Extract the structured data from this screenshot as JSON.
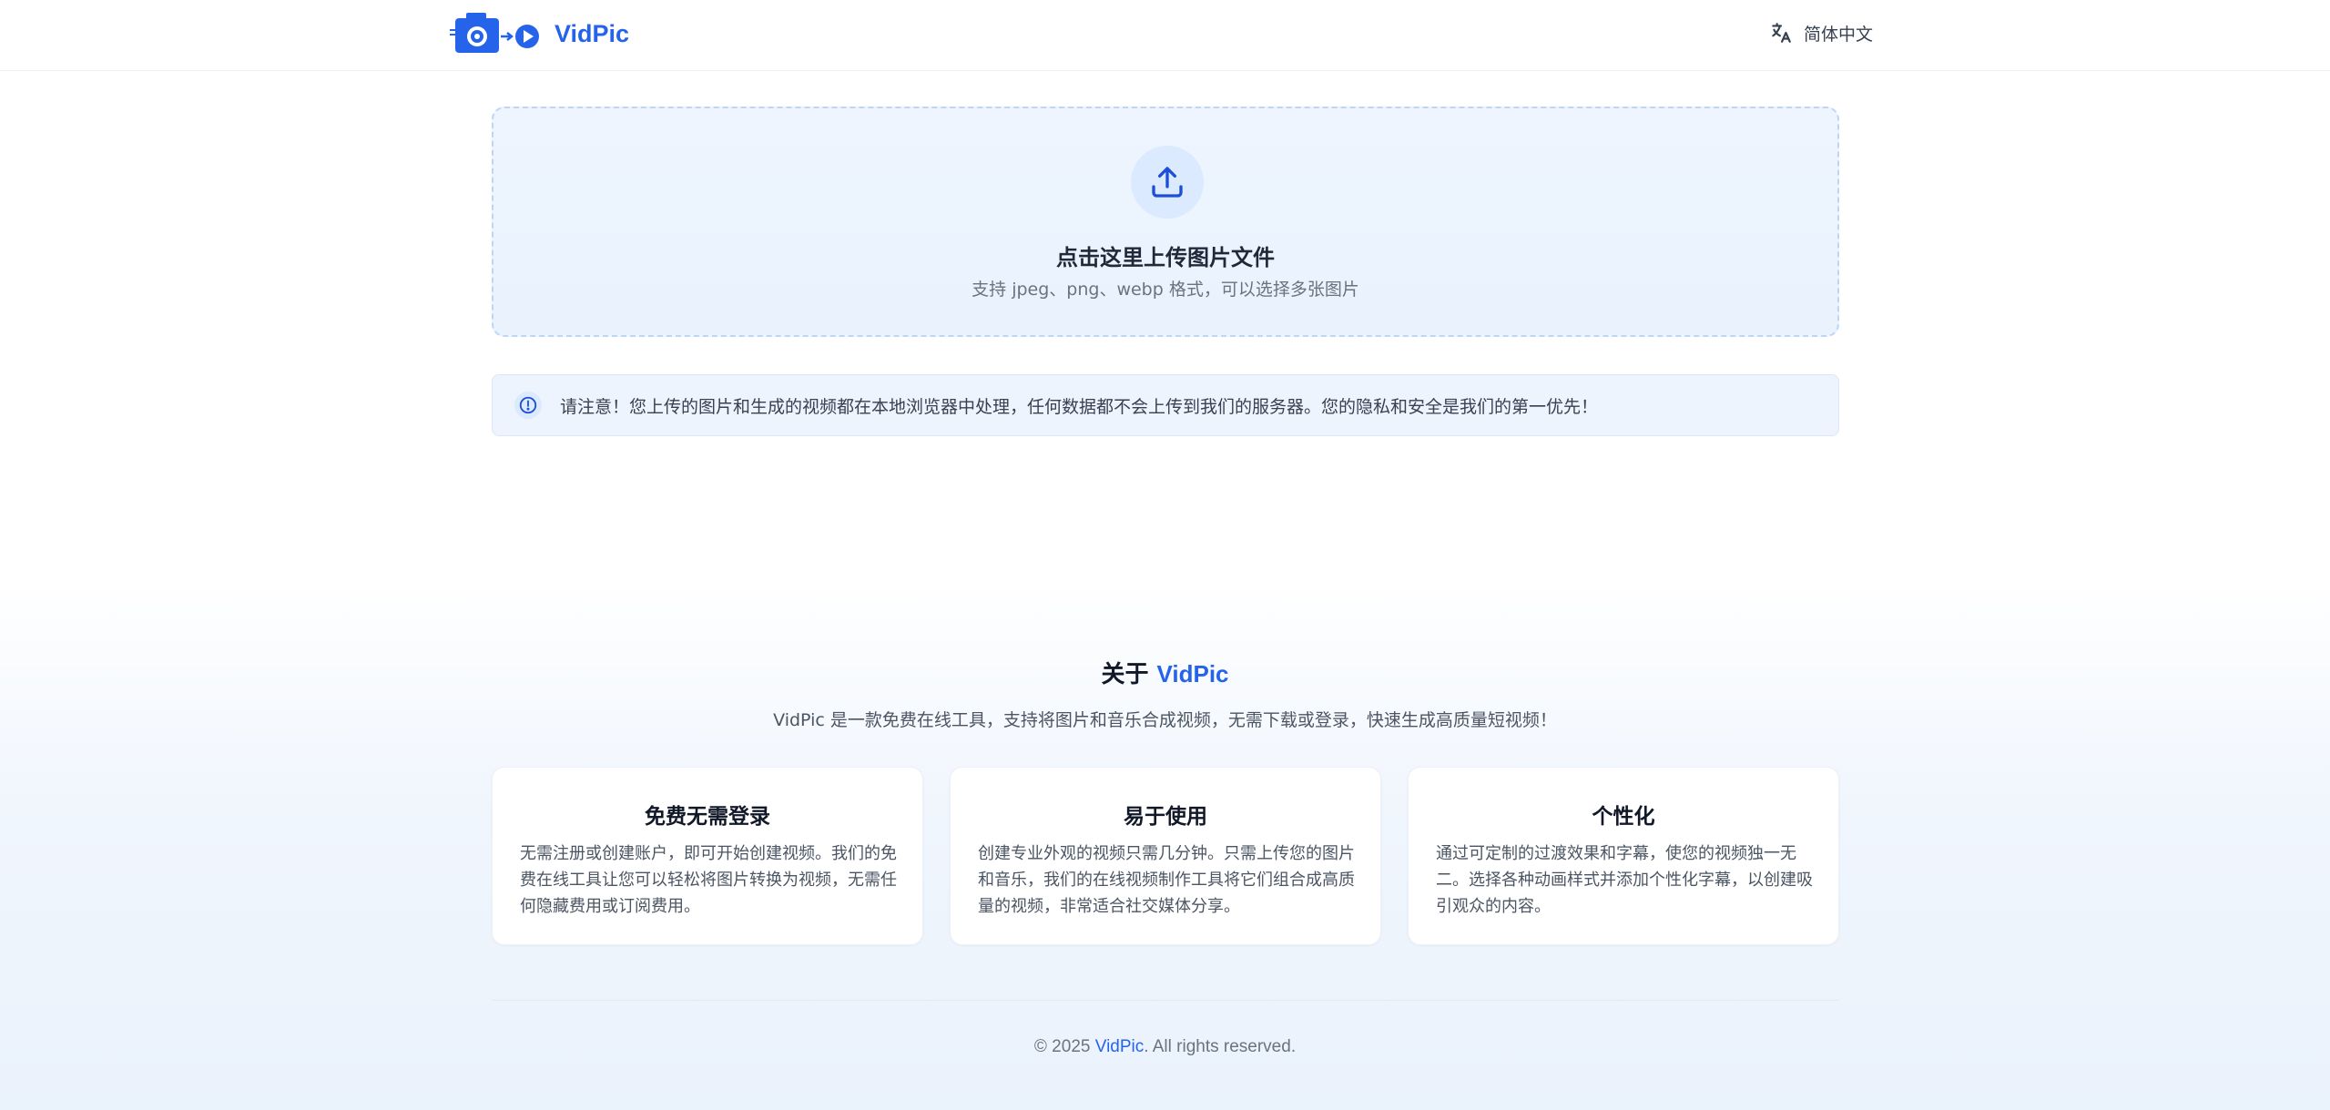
{
  "header": {
    "brand": "VidPic",
    "language_label": "简体中文",
    "logo_icon": "camera-to-play-icon",
    "language_icon": "translate-icon"
  },
  "upload": {
    "title": "点击这里上传图片文件",
    "subtitle": "支持 jpeg、png、webp 格式，可以选择多张图片",
    "icon": "upload-icon"
  },
  "notice": {
    "text": "请注意！您上传的图片和生成的视频都在本地浏览器中处理，任何数据都不会上传到我们的服务器。您的隐私和安全是我们的第一优先！",
    "icon": "info-circle-icon"
  },
  "about": {
    "title_prefix": "关于 ",
    "title_brand": "VidPic",
    "description": "VidPic 是一款免费在线工具，支持将图片和音乐合成视频，无需下载或登录，快速生成高质量短视频！"
  },
  "features": [
    {
      "title": "免费无需登录",
      "lines": [
        "无需注册或创建账户，即可开始创建视频。我们的免",
        "费在线工具让您可以轻松将图片转换为视频，无需任",
        "何隐藏费用或订阅费用。"
      ]
    },
    {
      "title": "易于使用",
      "lines": [
        "创建专业外观的视频只需几分钟。只需上传您的图片",
        "和音乐，我们的在线视频制作工具将它们组合成高质",
        "量的视频，非常适合社交媒体分享。"
      ]
    },
    {
      "title": "个性化",
      "lines": [
        "通过可定制的过渡效果和字幕，使您的视频独一无",
        "二。选择各种动画样式并添加个性化字幕，以创建吸",
        "引观众的内容。"
      ]
    }
  ],
  "footer": {
    "prefix": "© 2025 ",
    "brand": "VidPic",
    "suffix": ". All rights reserved."
  },
  "colors": {
    "accent": "#2563eb",
    "upload_bg": "#eef5ff",
    "notice_bg": "#eef4fd"
  }
}
